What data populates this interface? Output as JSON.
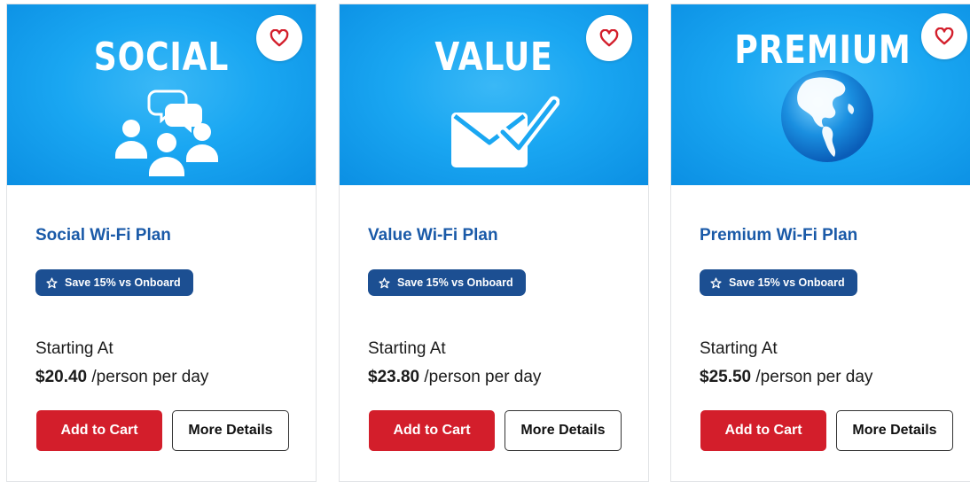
{
  "colors": {
    "hero_blue": "#1aa7f2",
    "title_blue": "#1a5aa8",
    "badge_blue": "#1c4f92",
    "cart_red": "#d31e2b",
    "heart_red": "#d31e2b"
  },
  "plans": [
    {
      "hero_text": "SOCIAL",
      "hero_icon": "people-chat-icon",
      "title": "Social Wi-Fi Plan",
      "badge": "Save 15% vs Onboard",
      "starting_label": "Starting At",
      "price": "$20.40",
      "unit": "/person per day",
      "add_to_cart": "Add to Cart",
      "more_details": "More Details"
    },
    {
      "hero_text": "VALUE",
      "hero_icon": "envelope-check-icon",
      "title": "Value Wi-Fi Plan",
      "badge": "Save 15% vs Onboard",
      "starting_label": "Starting At",
      "price": "$23.80",
      "unit": "/person per day",
      "add_to_cart": "Add to Cart",
      "more_details": "More Details"
    },
    {
      "hero_text": "PREMIUM",
      "hero_icon": "globe-icon",
      "title": "Premium Wi-Fi Plan",
      "badge": "Save 15% vs Onboard",
      "starting_label": "Starting At",
      "price": "$25.50",
      "unit": "/person per day",
      "add_to_cart": "Add to Cart",
      "more_details": "More Details"
    }
  ]
}
